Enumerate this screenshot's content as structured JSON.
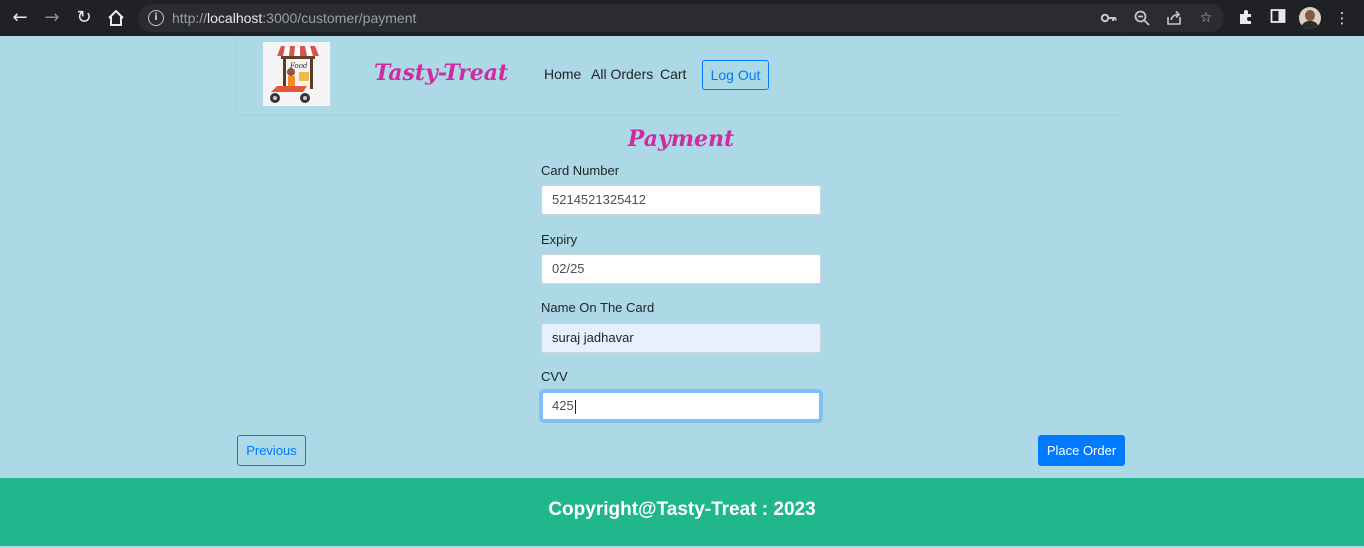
{
  "browser": {
    "url_prefix": "http://",
    "url_host": "localhost",
    "url_rest": ":3000/customer/payment",
    "icons": [
      "back-arrow-icon",
      "forward-arrow-icon",
      "reload-icon",
      "home-icon",
      "info-icon",
      "key-icon",
      "zoom-icon",
      "share-icon",
      "star-icon",
      "extensions-icon",
      "side-panel-icon",
      "profile-avatar",
      "menu-icon"
    ]
  },
  "navbar": {
    "brand": "Tasty-Treat",
    "logo_text": "Food",
    "links": [
      "Home",
      "All Orders",
      "Cart"
    ],
    "logout_label": "Log Out"
  },
  "form": {
    "title": "Payment",
    "card_number_label": "Card Number",
    "card_number_value": "5214521325412",
    "expiry_label": "Expiry",
    "expiry_value": "02/25",
    "name_label": "Name On The Card",
    "name_value": "suraj jadhavar",
    "cvv_label": "CVV",
    "cvv_value": "425"
  },
  "actions": {
    "previous_label": "Previous",
    "place_order_label": "Place Order"
  },
  "footer": {
    "text": "Copyright@Tasty-Treat : 2023"
  },
  "colors": {
    "page_bg": "#add8e6",
    "brand": "#d02ba2",
    "primary": "#007bff",
    "footer_bg": "#20b78c"
  }
}
